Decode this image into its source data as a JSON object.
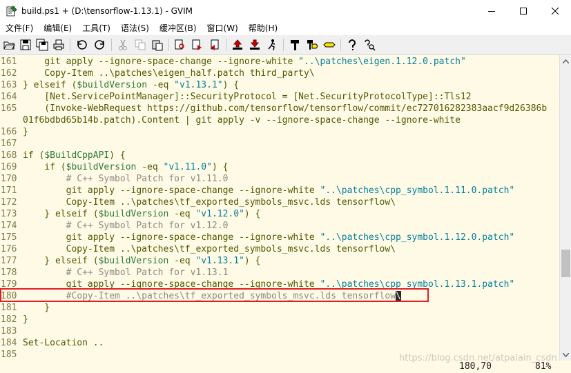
{
  "window": {
    "title": "build.ps1 + (D:\\tensorflow-1.13.1) - GVIM",
    "minimize_icon": "minimize-icon",
    "maximize_icon": "maximize-icon",
    "close_icon": "close-icon"
  },
  "menu": {
    "items": [
      {
        "label": "文件(F)"
      },
      {
        "label": "编辑(E)"
      },
      {
        "label": "工具(T)"
      },
      {
        "label": "语法(S)"
      },
      {
        "label": "缓冲区(B)"
      },
      {
        "label": "窗口(W)"
      },
      {
        "label": "帮助(H)"
      }
    ]
  },
  "toolbar": {
    "buttons": [
      {
        "icon": "open-icon"
      },
      {
        "icon": "save-icon"
      },
      {
        "icon": "save-all-icon"
      },
      {
        "icon": "print-icon"
      },
      {
        "icon": "undo-icon"
      },
      {
        "icon": "redo-icon"
      },
      {
        "icon": "cut-icon"
      },
      {
        "icon": "copy-icon"
      },
      {
        "icon": "paste-icon"
      },
      {
        "icon": "find-replace-icon"
      },
      {
        "icon": "find-next-icon"
      },
      {
        "icon": "find-prev-icon"
      },
      {
        "icon": "load-session-icon"
      },
      {
        "icon": "save-session-icon"
      },
      {
        "icon": "run-script-icon"
      },
      {
        "icon": "make-icon"
      },
      {
        "icon": "run-ctags-icon"
      },
      {
        "icon": "tag-jump-icon"
      },
      {
        "icon": "help-icon"
      },
      {
        "icon": "find-help-icon"
      }
    ]
  },
  "editor": {
    "lines": [
      {
        "num": "161",
        "segs": [
          {
            "t": "def",
            "v": "    git apply --ignore-space-change --ignore-white "
          },
          {
            "t": "str",
            "v": "\"..\\patches\\eigen.1.12.0.patch\""
          }
        ]
      },
      {
        "num": "162",
        "segs": [
          {
            "t": "def",
            "v": "    Copy-Item ..\\patches\\eigen_half.patch third_party\\"
          }
        ]
      },
      {
        "num": "163",
        "segs": [
          {
            "t": "def",
            "v": "} elseif ("
          },
          {
            "t": "var",
            "v": "$buildVersion"
          },
          {
            "t": "def",
            "v": " -eq "
          },
          {
            "t": "str",
            "v": "\"v1.13.1\""
          },
          {
            "t": "def",
            "v": ") {"
          }
        ]
      },
      {
        "num": "164",
        "segs": [
          {
            "t": "def",
            "v": "    [Net.ServicePointManager]::SecurityProtocol = [Net.SecurityProtocolType]::Tls12"
          }
        ]
      },
      {
        "num": "165",
        "segs": [
          {
            "t": "def",
            "v": "    (Invoke-WebRequest https://github.com/tensorflow/tensorflow/commit/ec727016282383aacf9d26386b"
          }
        ]
      },
      {
        "num": "",
        "segs": [
          {
            "t": "def",
            "v": "01f6bdbd65b14b.patch).Content | git apply -v --ignore-space-change --ignore-white"
          }
        ]
      },
      {
        "num": "166",
        "segs": [
          {
            "t": "def",
            "v": "}"
          }
        ]
      },
      {
        "num": "167",
        "segs": []
      },
      {
        "num": "168",
        "segs": [
          {
            "t": "def",
            "v": "if ("
          },
          {
            "t": "var",
            "v": "$BuildCppAPI"
          },
          {
            "t": "def",
            "v": ") {"
          }
        ]
      },
      {
        "num": "169",
        "segs": [
          {
            "t": "def",
            "v": "    if ("
          },
          {
            "t": "var",
            "v": "$buildVersion"
          },
          {
            "t": "def",
            "v": " -eq "
          },
          {
            "t": "str",
            "v": "\"v1.11.0\""
          },
          {
            "t": "def",
            "v": ") {"
          }
        ]
      },
      {
        "num": "170",
        "segs": [
          {
            "t": "cmt",
            "v": "        # C++ Symbol Patch for v1.11.0"
          }
        ]
      },
      {
        "num": "171",
        "segs": [
          {
            "t": "def",
            "v": "        git apply --ignore-space-change --ignore-white "
          },
          {
            "t": "str",
            "v": "\"..\\patches\\cpp_symbol.1.11.0.patch\""
          }
        ]
      },
      {
        "num": "172",
        "segs": [
          {
            "t": "def",
            "v": "        Copy-Item ..\\patches\\tf_exported_symbols_msvc.lds tensorflow\\"
          }
        ]
      },
      {
        "num": "173",
        "segs": [
          {
            "t": "def",
            "v": "    } elseif ("
          },
          {
            "t": "var",
            "v": "$buildVersion"
          },
          {
            "t": "def",
            "v": " -eq "
          },
          {
            "t": "str",
            "v": "\"v1.12.0\""
          },
          {
            "t": "def",
            "v": ") {"
          }
        ]
      },
      {
        "num": "174",
        "segs": [
          {
            "t": "cmt",
            "v": "        # C++ Symbol Patch for v1.12.0"
          }
        ]
      },
      {
        "num": "175",
        "segs": [
          {
            "t": "def",
            "v": "        git apply --ignore-space-change --ignore-white "
          },
          {
            "t": "str",
            "v": "\"..\\patches\\cpp_symbol.1.12.0.patch\""
          }
        ]
      },
      {
        "num": "176",
        "segs": [
          {
            "t": "def",
            "v": "        Copy-Item ..\\patches\\tf_exported_symbols_msvc.lds tensorflow\\"
          }
        ]
      },
      {
        "num": "177",
        "segs": [
          {
            "t": "def",
            "v": "    } elseif ("
          },
          {
            "t": "var",
            "v": "$buildVersion"
          },
          {
            "t": "def",
            "v": " -eq "
          },
          {
            "t": "str",
            "v": "\"v1.13.1\""
          },
          {
            "t": "def",
            "v": ") {"
          }
        ]
      },
      {
        "num": "178",
        "segs": [
          {
            "t": "cmt",
            "v": "        # C++ Symbol Patch for v1.13.1"
          }
        ]
      },
      {
        "num": "179",
        "segs": [
          {
            "t": "def",
            "v": "        git apply --ignore-space-change --ignore-white "
          },
          {
            "t": "str",
            "v": "\"..\\patches\\cpp_symbol.1.13.1.patch\""
          }
        ]
      },
      {
        "num": "180",
        "segs": [
          {
            "t": "cmt",
            "v": "        #Copy-Item ..\\patches\\tf_exported_symbols_msvc.lds tensorflow"
          },
          {
            "t": "cursor",
            "v": "\\"
          }
        ]
      },
      {
        "num": "181",
        "segs": [
          {
            "t": "def",
            "v": "    }"
          }
        ]
      },
      {
        "num": "182",
        "segs": [
          {
            "t": "def",
            "v": "}"
          }
        ]
      },
      {
        "num": "183",
        "segs": []
      },
      {
        "num": "184",
        "segs": [
          {
            "t": "def",
            "v": "Set-Location .."
          }
        ]
      },
      {
        "num": "185",
        "segs": []
      }
    ]
  },
  "status": {
    "position": "180,70",
    "percent": "81%",
    "watermark": "https://blog.csdn.net/atpalain_csdn"
  },
  "colors": {
    "editor_bg": "#fffae6",
    "string": "#00809a",
    "variable": "#2a7a3a",
    "comment": "#8a8a80",
    "line_number": "#7c7c4a",
    "highlight_border": "#e01e25"
  }
}
